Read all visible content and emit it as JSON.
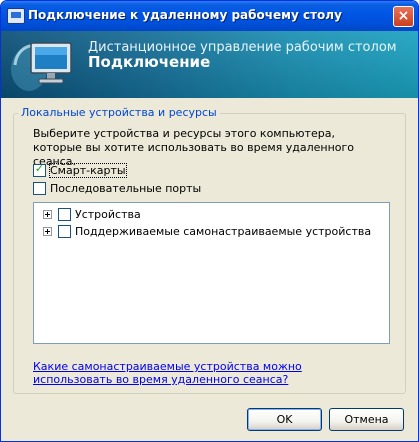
{
  "window": {
    "title": "Подключение к удаленному рабочему столу",
    "close_symbol": "×"
  },
  "banner": {
    "line1": "Дистанционное управление рабочим столом",
    "line2": "Подключение",
    "logo_icon": "remote-desktop-monitor-icon"
  },
  "group": {
    "legend": "Локальные устройства и ресурсы",
    "description": "Выберите устройства и ресурсы этого компьютера, которые вы хотите использовать во время удаленного сеанса.",
    "checkboxes": [
      {
        "label": "Смарт-карты",
        "checked": true,
        "check_symbol": "✓"
      },
      {
        "label": "Последовательные порты",
        "checked": false
      }
    ],
    "tree": [
      {
        "label": "Устройства",
        "checked": false
      },
      {
        "label": "Поддерживаемые самонастраиваемые устройства",
        "checked": false
      }
    ],
    "help_link": "Какие самонастраиваемые устройства можно использовать во время удаленного сеанса?"
  },
  "buttons": {
    "ok": "OK",
    "cancel": "Отмена"
  },
  "colors": {
    "titlebar": "#0055e5",
    "banner_left": "#0b4f78",
    "banner_right": "#1aa2c0",
    "legend_text": "#0046d5",
    "link": "#0000ee",
    "dialog_bg": "#ece9d8"
  }
}
